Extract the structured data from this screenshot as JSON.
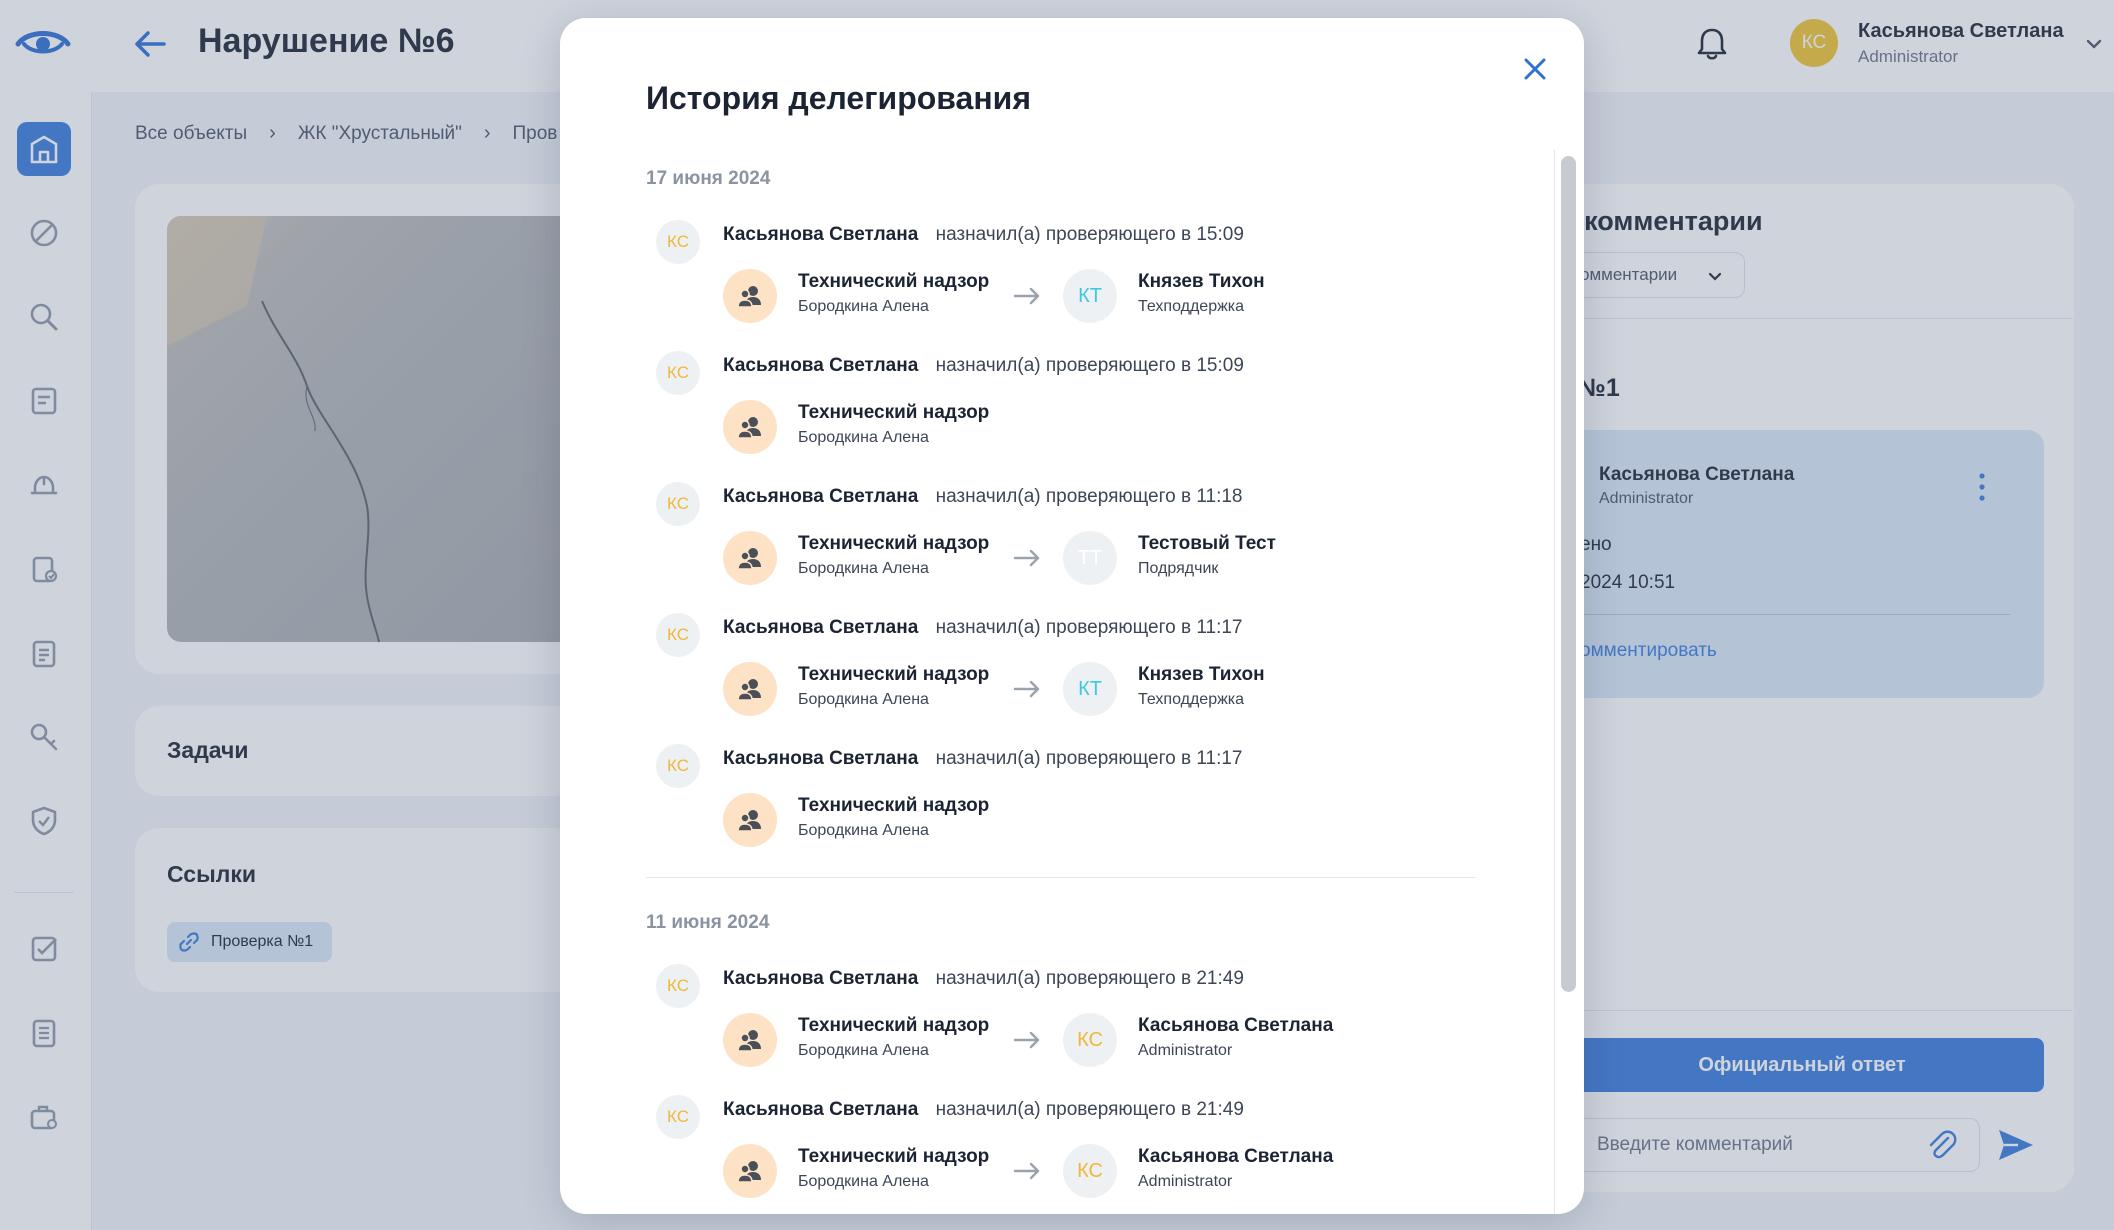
{
  "header": {
    "title": "Нарушение №6",
    "user": {
      "initials": "КС",
      "name": "Касьянова Светлана",
      "role": "Administrator"
    }
  },
  "breadcrumb": [
    "Все объекты",
    "ЖК \"Хрустальный\"",
    "Пров"
  ],
  "left_cards": {
    "tasks_title": "Задачи",
    "links_title": "Ссылки",
    "link_chip": "Проверка №1"
  },
  "right_panel": {
    "title": "и комментарии",
    "filter_value": "омментарии",
    "check_title": "№1",
    "comment": {
      "author": "Касьянова Светлана",
      "role": "Administrator",
      "status": "ено",
      "date": "2024 10:51",
      "reply": "омментировать"
    },
    "official_button": "Официальный ответ",
    "comment_placeholder": "Введите комментарий"
  },
  "modal": {
    "title": "История делегирования",
    "groups": [
      {
        "date": "17 июня 2024",
        "entries": [
          {
            "actor_initials": "КС",
            "actor": "Касьянова Светлана",
            "action": "назначил(а) проверяющего в 15:09",
            "from_role": "Технический надзор",
            "from_name": "Бородкина Алена",
            "to": {
              "initials": "КТ",
              "name": "Князев Тихон",
              "role": "Техподдержка",
              "color": "#3fc9e0"
            }
          },
          {
            "actor_initials": "КС",
            "actor": "Касьянова Светлана",
            "action": "назначил(а) проверяющего в 15:09",
            "from_role": "Технический надзор",
            "from_name": "Бородкина Алена",
            "to": null
          },
          {
            "actor_initials": "КС",
            "actor": "Касьянова Светлана",
            "action": "назначил(а) проверяющего в 11:18",
            "from_role": "Технический надзор",
            "from_name": "Бородкина Алена",
            "to": {
              "initials": "ТТ",
              "name": "Тестовый Тест",
              "role": "Подрядчик",
              "color": "#ffffff"
            }
          },
          {
            "actor_initials": "КС",
            "actor": "Касьянова Светлана",
            "action": "назначил(а) проверяющего в 11:17",
            "from_role": "Технический надзор",
            "from_name": "Бородкина Алена",
            "to": {
              "initials": "КТ",
              "name": "Князев Тихон",
              "role": "Техподдержка",
              "color": "#3fc9e0"
            }
          },
          {
            "actor_initials": "КС",
            "actor": "Касьянова Светлана",
            "action": "назначил(а) проверяющего в 11:17",
            "from_role": "Технический надзор",
            "from_name": "Бородкина Алена",
            "to": null
          }
        ]
      },
      {
        "date": "11 июня 2024",
        "entries": [
          {
            "actor_initials": "КС",
            "actor": "Касьянова Светлана",
            "action": "назначил(а) проверяющего в 21:49",
            "from_role": "Технический надзор",
            "from_name": "Бородкина Алена",
            "to": {
              "initials": "КС",
              "name": "Касьянова Светлана",
              "role": "Administrator",
              "color": "#f0b73a"
            }
          },
          {
            "actor_initials": "КС",
            "actor": "Касьянова Светлана",
            "action": "назначил(а) проверяющего в 21:49",
            "from_role": "Технический надзор",
            "from_name": "Бородкина Алена",
            "to": {
              "initials": "КС",
              "name": "Касьянова Светлана",
              "role": "Administrator",
              "color": "#f0b73a"
            }
          }
        ]
      }
    ]
  },
  "colors": {
    "accent": "#3a7bdc",
    "actor_initials": "#f0b73a",
    "user_avatar": "#f3c531"
  },
  "icons": [
    "eye-logo-icon",
    "back-arrow-icon",
    "bell-icon",
    "chevron-down-icon",
    "close-icon",
    "arrow-right-icon",
    "user-group-icon",
    "link-icon",
    "paperclip-icon",
    "send-icon",
    "more-vertical-icon"
  ]
}
